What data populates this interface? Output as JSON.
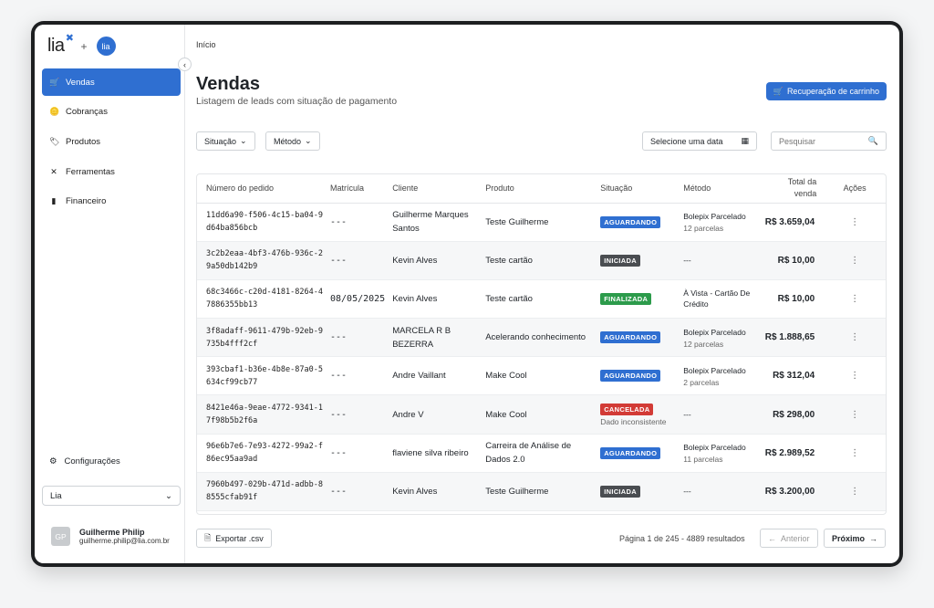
{
  "sidebar": {
    "logo": "lia",
    "logo_plus": "+",
    "logo_badge": "lia",
    "collapse": "‹",
    "items": [
      {
        "label": "Vendas",
        "icon": "🛒"
      },
      {
        "label": "Cobranças",
        "icon": "🪙"
      },
      {
        "label": "Produtos",
        "icon": "🏷"
      },
      {
        "label": "Ferramentas",
        "icon": "✕"
      },
      {
        "label": "Financeiro",
        "icon": "▮"
      }
    ],
    "settings_label": "Configurações",
    "workspace_select": "Lia",
    "user": {
      "initials": "GP",
      "name": "Guilherme Philip",
      "email": "guilherme.philip@lia.com.br"
    }
  },
  "header": {
    "breadcrumb": "Início",
    "title": "Vendas",
    "subtitle": "Listagem de leads com situação de pagamento",
    "primary_button": "Recuperação de carrinho"
  },
  "filters": {
    "situacao": "Situação",
    "metodo": "Método",
    "date": "Selecione uma data",
    "search_placeholder": "Pesquisar"
  },
  "table": {
    "columns": [
      "Número do pedido",
      "Matrícula",
      "Cliente",
      "Produto",
      "Situação",
      "Método",
      "Total da venda",
      "Ações"
    ],
    "rows": [
      {
        "order": "11dd6a90-f506-4c15-ba04-9d64ba856bcb",
        "matricula": "---",
        "cliente": "Guilherme Marques Santos",
        "produto": "Teste Guilherme",
        "situacao": "AGUARDANDO",
        "situacao_color": "blue",
        "situacao_note": "",
        "metodo": "Bolepix Parcelado",
        "metodo_sub": "12 parcelas",
        "total": "R$ 3.659,04"
      },
      {
        "order": "3c2b2eaa-4bf3-476b-936c-29a50db142b9",
        "matricula": "---",
        "cliente": "Kevin Alves",
        "produto": "Teste cartão",
        "situacao": "INICIADA",
        "situacao_color": "gray",
        "situacao_note": "",
        "metodo": "---",
        "metodo_sub": "",
        "total": "R$ 10,00"
      },
      {
        "order": "68c3466c-c20d-4181-8264-47886355bb13",
        "matricula": "08/05/2025",
        "cliente": "Kevin Alves",
        "produto": "Teste cartão",
        "situacao": "FINALIZADA",
        "situacao_color": "green",
        "situacao_note": "",
        "metodo": "À Vista - Cartão De Crédito",
        "metodo_sub": "",
        "total": "R$ 10,00"
      },
      {
        "order": "3f8adaff-9611-479b-92eb-9735b4fff2cf",
        "matricula": "---",
        "cliente": "MARCELA R B BEZERRA",
        "produto": "Acelerando conhecimento",
        "situacao": "AGUARDANDO",
        "situacao_color": "blue",
        "situacao_note": "",
        "metodo": "Bolepix Parcelado",
        "metodo_sub": "12 parcelas",
        "total": "R$ 1.888,65"
      },
      {
        "order": "393cbaf1-b36e-4b8e-87a0-5634cf99cb77",
        "matricula": "---",
        "cliente": "Andre Vaillant",
        "produto": "Make Cool",
        "situacao": "AGUARDANDO",
        "situacao_color": "blue",
        "situacao_note": "",
        "metodo": "Bolepix Parcelado",
        "metodo_sub": "2 parcelas",
        "total": "R$ 312,04"
      },
      {
        "order": "8421e46a-9eae-4772-9341-17f98b5b2f6a",
        "matricula": "---",
        "cliente": "Andre V",
        "produto": "Make Cool",
        "situacao": "CANCELADA",
        "situacao_color": "red",
        "situacao_note": "Dado inconsistente",
        "metodo": "---",
        "metodo_sub": "",
        "total": "R$ 298,00"
      },
      {
        "order": "96e6b7e6-7e93-4272-99a2-f86ec95aa9ad",
        "matricula": "---",
        "cliente": "flaviene silva ribeiro",
        "produto": "Carreira de Análise de Dados 2.0",
        "situacao": "AGUARDANDO",
        "situacao_color": "blue",
        "situacao_note": "",
        "metodo": "Bolepix Parcelado",
        "metodo_sub": "11 parcelas",
        "total": "R$ 2.989,52"
      },
      {
        "order": "7960b497-029b-471d-adbb-88555cfab91f",
        "matricula": "---",
        "cliente": "Kevin Alves",
        "produto": "Teste Guilherme",
        "situacao": "INICIADA",
        "situacao_color": "gray",
        "situacao_note": "",
        "metodo": "---",
        "metodo_sub": "",
        "total": "R$ 3.200,00"
      }
    ],
    "actions_icon": "⋮"
  },
  "footer": {
    "export_label": "Exportar .csv",
    "pagination_info": "Página 1 de 245 - 4889 resultados",
    "prev_label": "Anterior",
    "next_label": "Próximo"
  },
  "colors": {
    "accent": "#2f6fd1",
    "blue": "#2f6fd1",
    "gray": "#4a4d51",
    "green": "#2c9b4b",
    "red": "#d23b36"
  }
}
